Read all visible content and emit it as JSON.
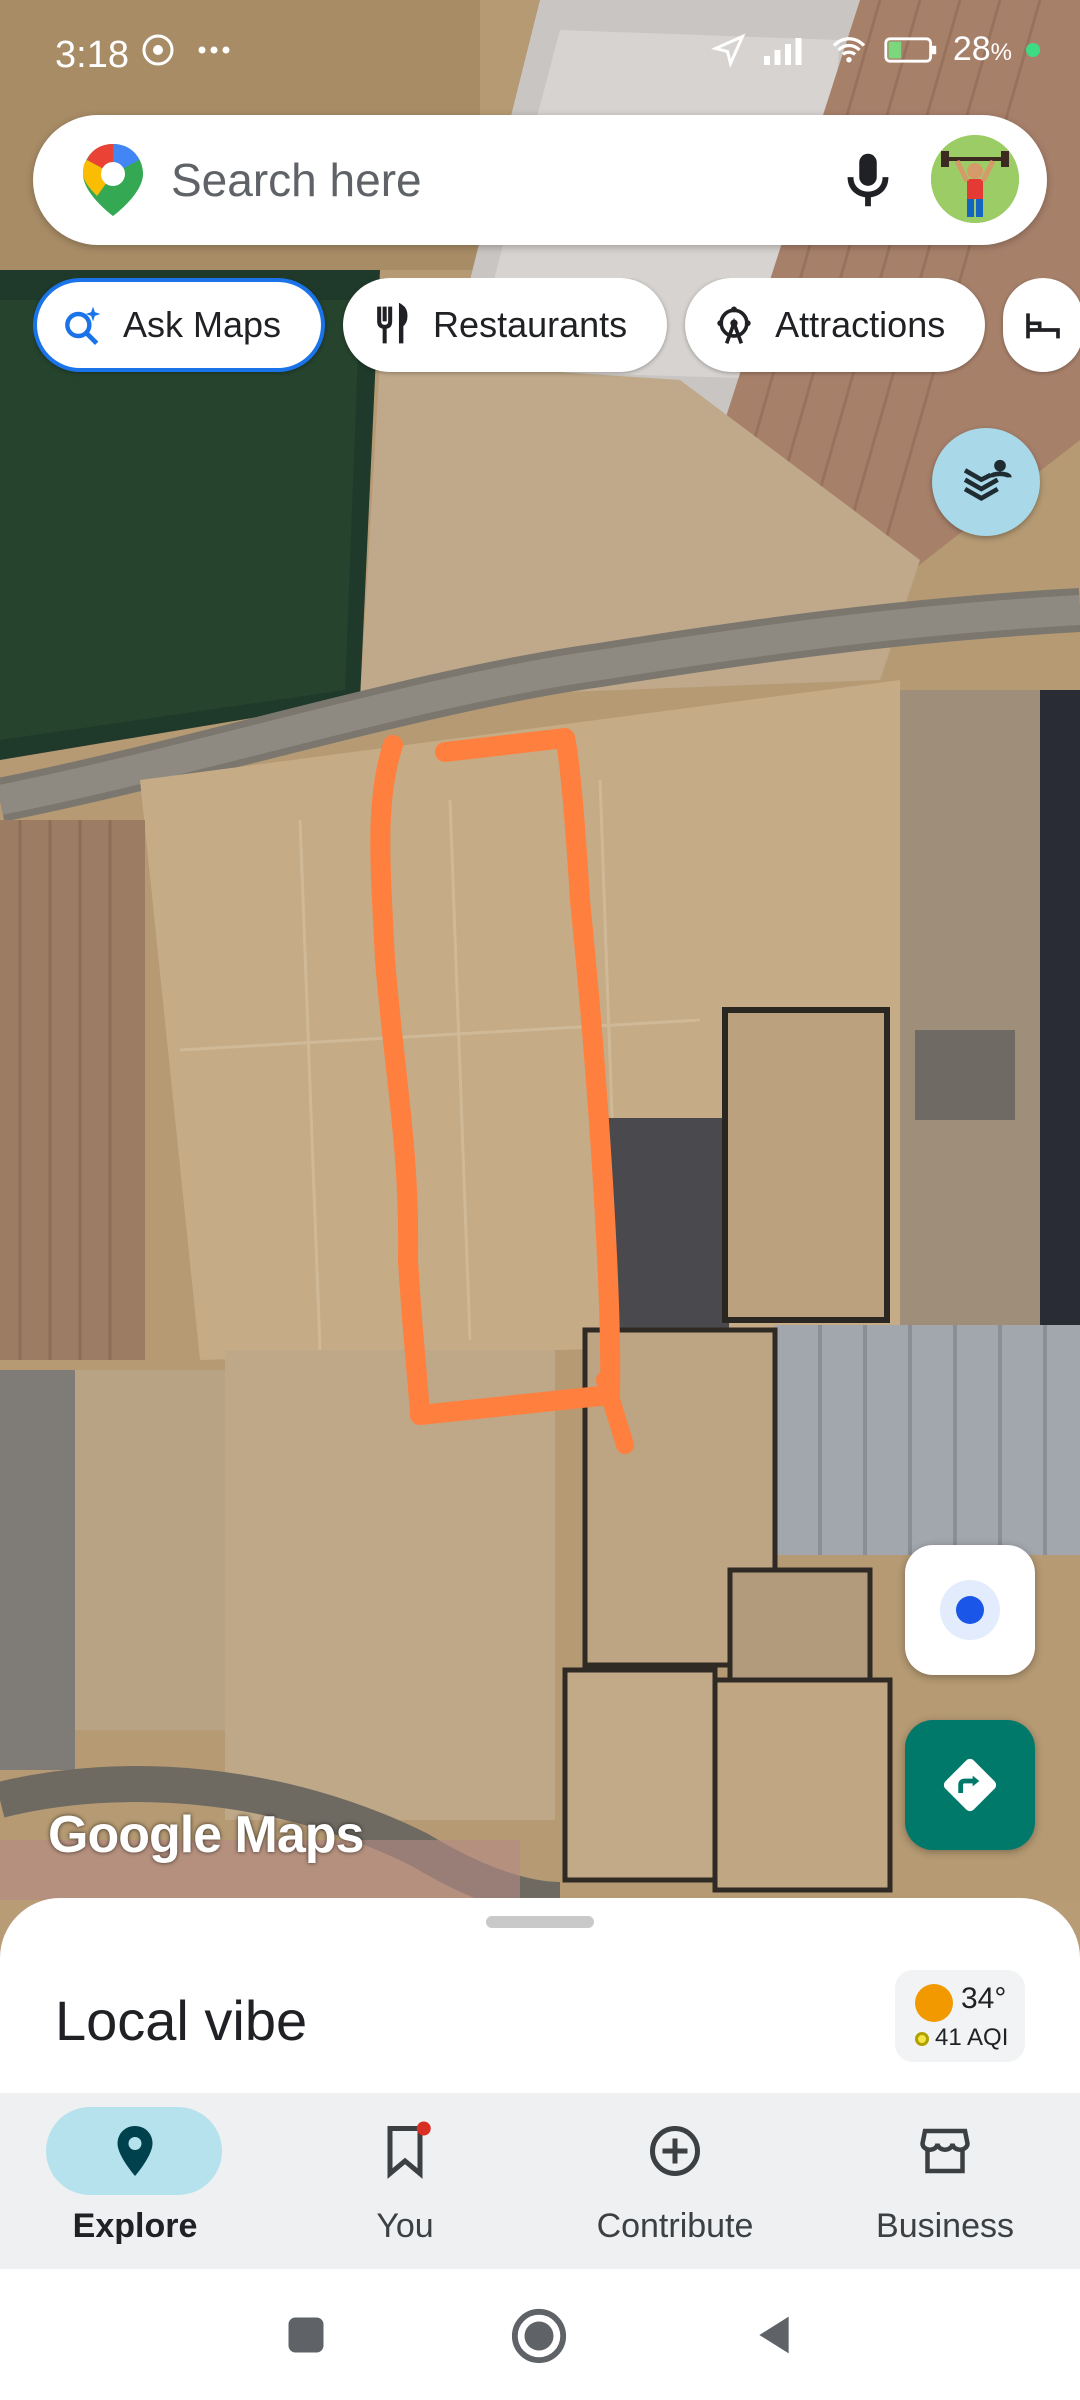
{
  "status_bar": {
    "time": "3:18",
    "battery": "28"
  },
  "search": {
    "placeholder": "Search here"
  },
  "chips": [
    {
      "label": "Ask Maps",
      "icon": "sparkle-search-icon"
    },
    {
      "label": "Restaurants",
      "icon": "fork-knife-icon"
    },
    {
      "label": "Attractions",
      "icon": "ferris-wheel-icon"
    }
  ],
  "map": {
    "watermark": "Google Maps"
  },
  "sheet": {
    "title": "Local vibe",
    "temperature": "34°",
    "aqi": "41 AQI"
  },
  "nav": [
    {
      "label": "Explore",
      "icon": "location-pin-icon",
      "active": true
    },
    {
      "label": "You",
      "icon": "bookmark-icon",
      "active": false
    },
    {
      "label": "Contribute",
      "icon": "add-circle-icon",
      "active": false
    },
    {
      "label": "Business",
      "icon": "storefront-icon",
      "active": false
    }
  ],
  "colors": {
    "accent": "#1a73e8",
    "directions": "#00796b",
    "drawn_outline": "#ff7f3f",
    "nav_active_pill": "#b6e2ee"
  }
}
